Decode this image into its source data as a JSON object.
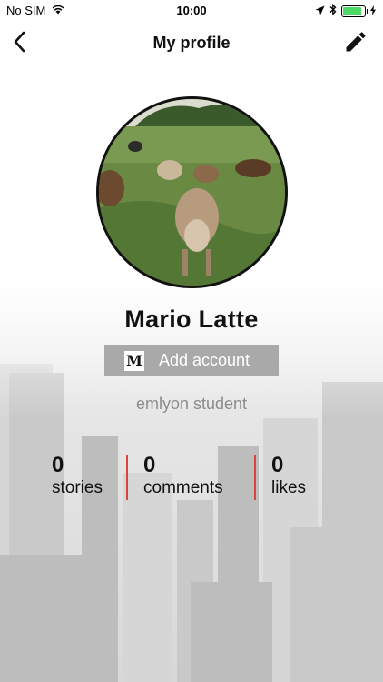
{
  "status_bar": {
    "carrier": "No SIM",
    "time": "10:00",
    "battery_level": 0.85
  },
  "nav": {
    "title": "My profile",
    "back_icon": "chevron-left-icon",
    "edit_icon": "pencil-icon"
  },
  "profile": {
    "name": "Mario Latte",
    "add_account_label": "Add account",
    "medium_logo": "M",
    "bio": "emlyon student"
  },
  "stats": [
    {
      "value": "0",
      "label": "stories"
    },
    {
      "value": "0",
      "label": "comments"
    },
    {
      "value": "0",
      "label": "likes"
    }
  ],
  "colors": {
    "divider": "#d9453a",
    "button_bg": "#a9a9a9",
    "battery": "#4cd964"
  }
}
